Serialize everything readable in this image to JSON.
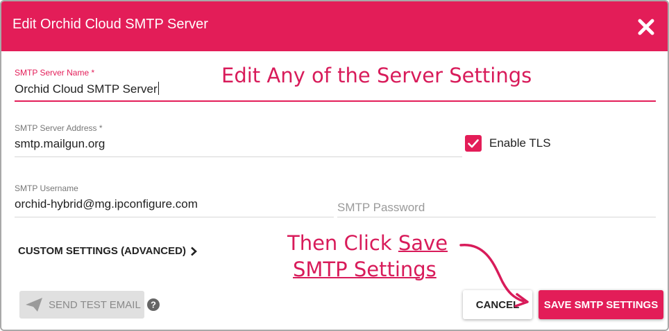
{
  "dialog": {
    "title": "Edit Orchid Cloud SMTP Server",
    "close_icon": "close-icon",
    "accent_color": "#e31d58"
  },
  "form": {
    "server_name": {
      "label": "SMTP Server Name *",
      "value": "Orchid Cloud SMTP Server"
    },
    "server_address": {
      "label": "SMTP Server Address *",
      "value": "smtp.mailgun.org"
    },
    "enable_tls": {
      "label": "Enable TLS",
      "checked": true
    },
    "username": {
      "label": "SMTP Username",
      "value": "orchid-hybrid@mg.ipconfigure.com"
    },
    "password": {
      "placeholder": "SMTP Password"
    },
    "custom_settings": {
      "label": "CUSTOM SETTINGS (ADVANCED)",
      "icon": "chevron-right-icon"
    }
  },
  "annotations": {
    "edit_hint": "Edit Any of the Server Settings",
    "save_hint_prefix": "Then Click ",
    "save_hint_link_line1": "Save",
    "save_hint_link_line2": "SMTP Settings"
  },
  "footer": {
    "send_test_label": "SEND TEST EMAIL",
    "send_test_icon": "paper-plane-icon",
    "help_icon": "help-icon",
    "cancel_label": "CANCEL",
    "save_label": "SAVE SMTP SETTINGS"
  }
}
